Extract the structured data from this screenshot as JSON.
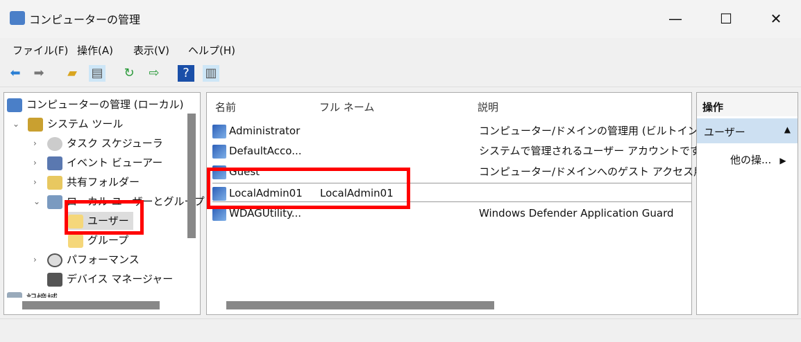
{
  "window": {
    "title": "コンピューターの管理",
    "minimize": "—",
    "maximize": "☐",
    "close": "✕"
  },
  "menu": [
    "ファイル(F)",
    "操作(A)",
    "表示(V)",
    "ヘルプ(H)"
  ],
  "toolbar_icons": [
    "back-arrow-icon",
    "forward-arrow-icon",
    "up-folder-icon",
    "show-tree-icon",
    "refresh-icon",
    "export-icon",
    "help-icon",
    "show-action-pane-icon"
  ],
  "tree": {
    "root": "コンピューターの管理 (ローカル)",
    "system_tools": "システム ツール",
    "items": [
      "タスク スケジューラ",
      "イベント ビューアー",
      "共有フォルダー",
      "ローカル ユーザーとグループ"
    ],
    "users": "ユーザー",
    "groups": "グループ",
    "performance": "パフォーマンス",
    "device_manager": "デバイス マネージャー",
    "storage": "記憶域"
  },
  "list": {
    "columns": [
      "名前",
      "フル ネーム",
      "説明"
    ],
    "rows": [
      {
        "name": "Administrator",
        "full": "",
        "desc": "コンピューター/ドメインの管理用 (ビルトイン アカ"
      },
      {
        "name": "DefaultAcco...",
        "full": "",
        "desc": "システムで管理されるユーザー アカウントです。"
      },
      {
        "name": "Guest",
        "full": "",
        "desc": "コンピューター/ドメインへのゲスト アクセス用 (ビ"
      },
      {
        "name": "LocalAdmin01",
        "full": "LocalAdmin01",
        "desc": ""
      },
      {
        "name": "WDAGUtility...",
        "full": "",
        "desc": "Windows Defender Application Guard"
      }
    ]
  },
  "actions": {
    "header": "操作",
    "section": "ユーザー",
    "more": "他の操..."
  },
  "colors": {
    "highlight": "#ff0000",
    "action_section": "#cde0f2"
  }
}
